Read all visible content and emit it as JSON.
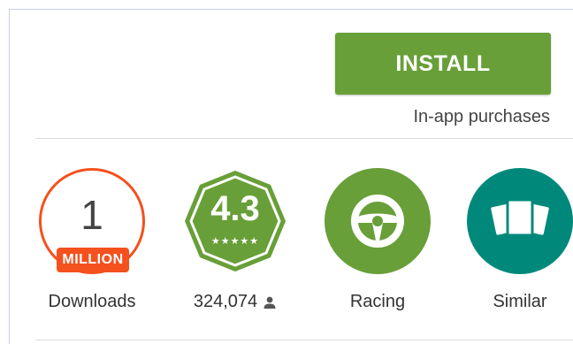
{
  "install": {
    "label": "INSTALL"
  },
  "in_app_note": "In-app purchases",
  "colors": {
    "install_green": "#689f38",
    "downloads_orange": "#f4511e",
    "rating_green": "#689f38",
    "category_green": "#689f38",
    "similar_teal": "#00897b"
  },
  "badges": {
    "downloads": {
      "number": "1",
      "unit": "MILLION",
      "label": "Downloads"
    },
    "rating": {
      "value": "4.3",
      "stars": "★★★★★",
      "count": "324,074",
      "count_icon": "person-icon"
    },
    "category": {
      "label": "Racing",
      "icon": "steering-wheel-icon"
    },
    "similar": {
      "label": "Similar",
      "icon": "cards-stack-icon"
    }
  }
}
